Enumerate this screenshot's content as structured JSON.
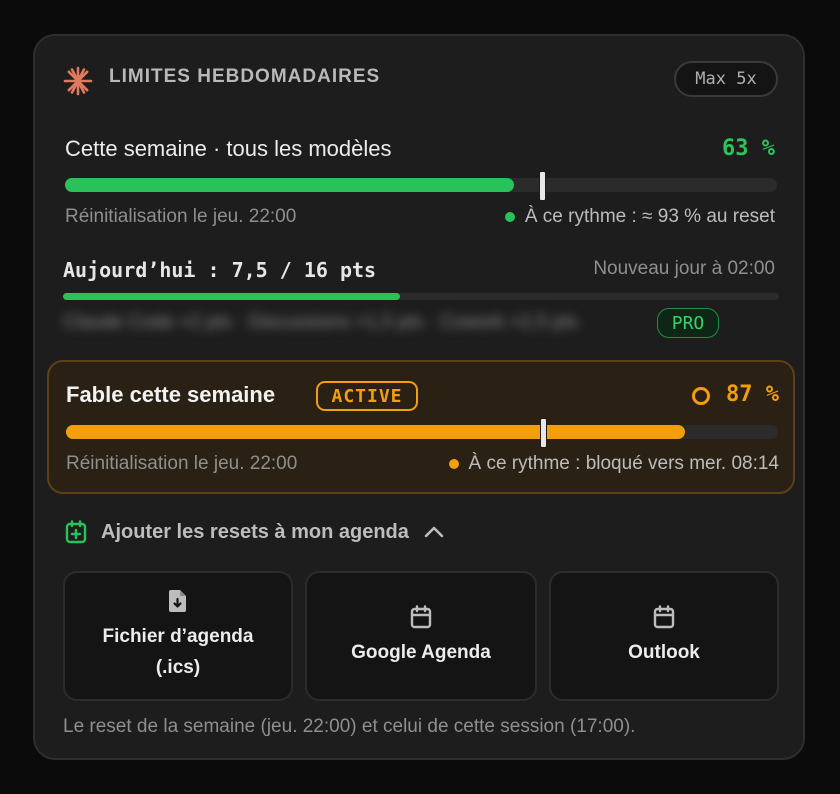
{
  "header": {
    "title": "LIMITES HEBDOMADAIRES",
    "plan_badge": "Max 5x"
  },
  "weekly_all": {
    "label": "Cette semaine · tous les modèles",
    "percent_text": "63 %",
    "usage_fraction": 0.63,
    "pace_marker_fraction": 0.67,
    "reset_text": "Réinitialisation le jeu. 22:00",
    "pace_text": "À ce rythme : ≈ 93 % au reset"
  },
  "today": {
    "label": "Aujourd’hui : 7,5 / 16 pts",
    "new_day_text": "Nouveau jour à 02:00",
    "usage_fraction": 0.47,
    "blurred_text": "Claude Code ×2 pts · Discussions ×1,5 pts · Cowork ×2,5 pts",
    "pro_badge": "PRO"
  },
  "fable": {
    "label": "Fable cette semaine",
    "status_badge": "ACTIVE",
    "percent_text": "87 %",
    "usage_fraction": 0.87,
    "pace_marker_fraction": 0.67,
    "reset_text": "Réinitialisation le jeu. 22:00",
    "pace_text": "À ce rythme : bloqué vers mer. 08:14"
  },
  "agenda": {
    "toggle_label": "Ajouter les resets à mon agenda",
    "buttons": [
      {
        "label_line1": "Fichier d’agenda",
        "label_line2": "(.ics)",
        "icon": "file-download-icon"
      },
      {
        "label_line1": "Google Agenda",
        "icon": "calendar-icon"
      },
      {
        "label_line1": "Outlook",
        "icon": "calendar-icon"
      }
    ]
  },
  "footer": "Le reset de la semaine (jeu. 22:00) et celui de cette session (17:00).",
  "colors": {
    "accent_green": "#29c25a",
    "accent_orange": "#f59e0b",
    "logo": "#e07a5f",
    "card_bg": "#1d1d1d"
  }
}
